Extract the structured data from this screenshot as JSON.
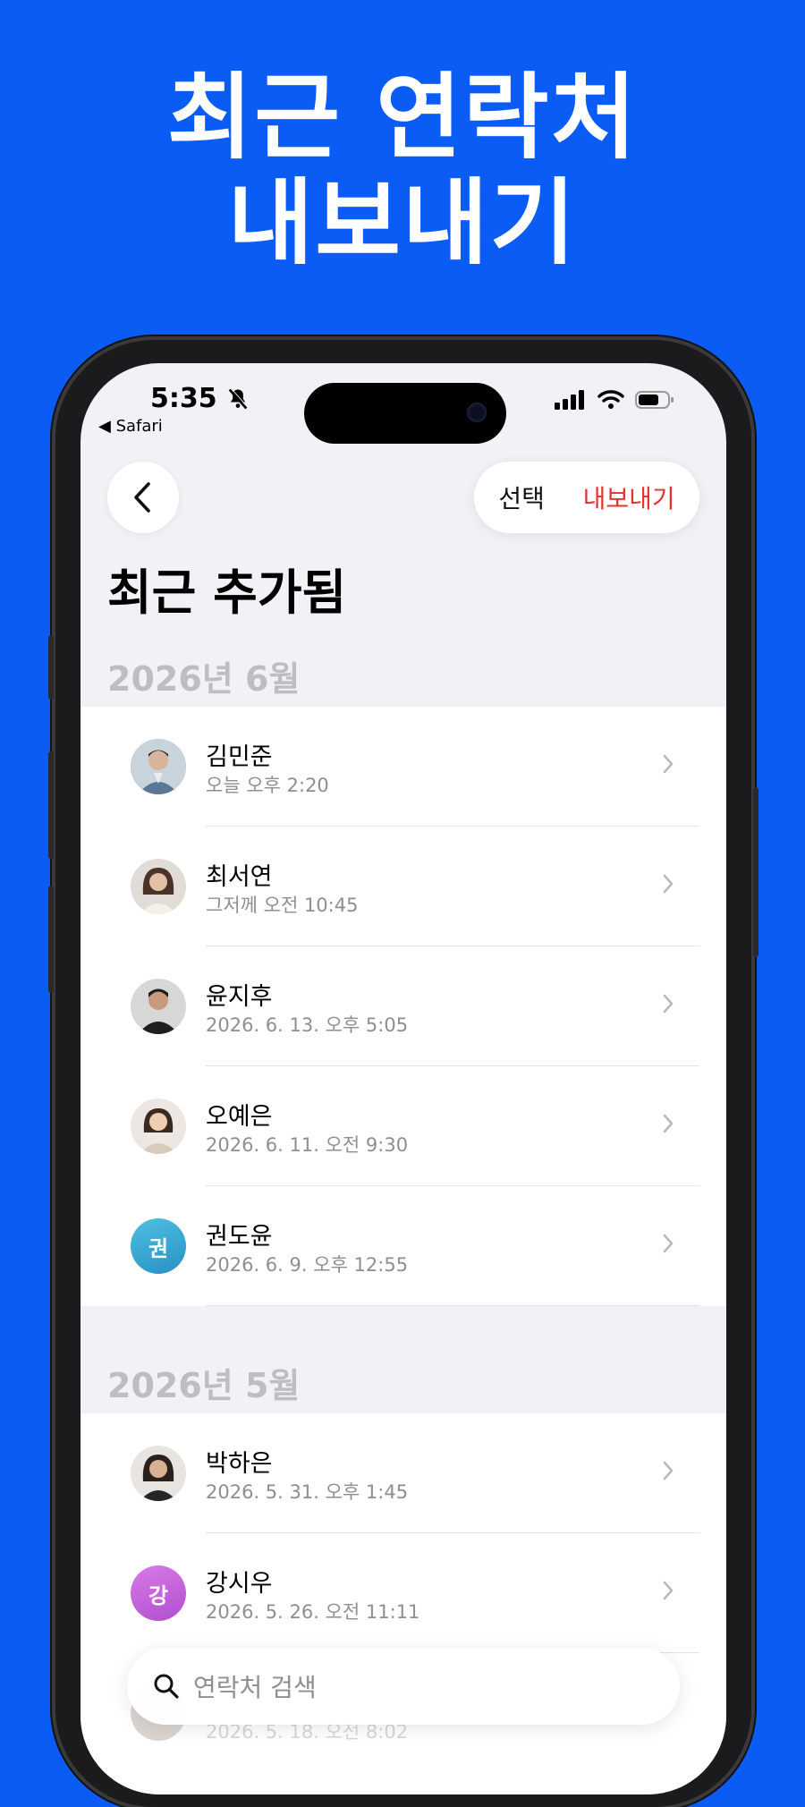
{
  "headline": {
    "line1": "최근 연락처",
    "line2": "내보내기"
  },
  "status_bar": {
    "time": "5:35",
    "back_app": "◀ Safari"
  },
  "toolbar": {
    "select_label": "선택",
    "export_label": "내보내기"
  },
  "page_title": "최근 추가됨",
  "sections": [
    {
      "header": "2026년 6월",
      "contacts": [
        {
          "name": "김민준",
          "date": "오늘 오후 2:20",
          "avatar_type": "photo",
          "avatar_color": "#8fa3b8"
        },
        {
          "name": "최서연",
          "date": "그저께 오전 10:45",
          "avatar_type": "photo",
          "avatar_color": "#a58a78"
        },
        {
          "name": "윤지후",
          "date": "2026. 6. 13. 오후 5:05",
          "avatar_type": "photo",
          "avatar_color": "#6a5a4e"
        },
        {
          "name": "오예은",
          "date": "2026. 6. 11. 오전 9:30",
          "avatar_type": "photo",
          "avatar_color": "#b09784"
        },
        {
          "name": "권도윤",
          "date": "2026. 6. 9. 오후 12:55",
          "avatar_type": "initial",
          "initial": "권",
          "avatar_color": "#2fa8cf"
        }
      ]
    },
    {
      "header": "2026년 5월",
      "contacts": [
        {
          "name": "박하은",
          "date": "2026. 5. 31. 오후 1:45",
          "avatar_type": "photo",
          "avatar_color": "#5d4a40"
        },
        {
          "name": "강시우",
          "date": "2026. 5. 26. 오전 11:11",
          "avatar_type": "initial",
          "initial": "강",
          "avatar_color": "#c25fd6"
        },
        {
          "name": "",
          "date": "2026. 5. 18. 오전 8:02",
          "avatar_type": "photo",
          "avatar_color": "#9a8a80"
        }
      ]
    }
  ],
  "search": {
    "placeholder": "연락처 검색"
  },
  "colors": {
    "background": "#0b5cf5",
    "accent_red": "#e8322d"
  }
}
